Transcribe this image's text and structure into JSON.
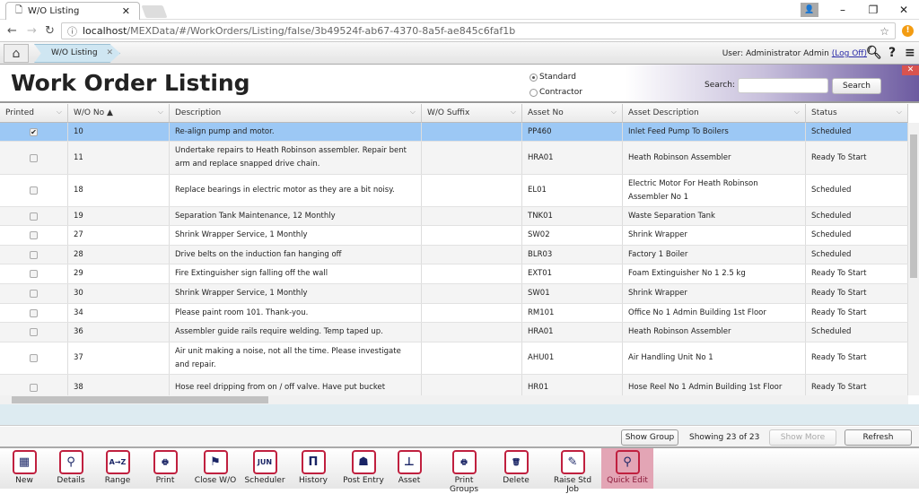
{
  "browser": {
    "tab_title": "W/O Listing",
    "url_host": "localhost",
    "url_path": "/MEXData/#/WorkOrders/Listing/false/3b49524f-ab67-4370-8a5f-ae845c6faf1b"
  },
  "app": {
    "tab_label": "W/O Listing",
    "user_label": "User: Administrator Admin",
    "logoff_label": "(Log Off)"
  },
  "header": {
    "title": "Work Order Listing",
    "radio_standard": "Standard",
    "radio_contractor": "Contractor",
    "selected_mode": "Standard",
    "search_label": "Search:",
    "search_value": "",
    "search_button": "Search"
  },
  "table": {
    "columns": [
      "Printed",
      "W/O No ▲",
      "Description",
      "W/O Suffix",
      "Asset No",
      "Asset Description",
      "Status"
    ],
    "rows": [
      {
        "printed": true,
        "wo": "10",
        "desc": "Re-align pump and motor.",
        "suffix": "",
        "asset": "PP460",
        "asset_desc": "Inlet Feed Pump To Boilers",
        "status": "Scheduled",
        "selected": true
      },
      {
        "printed": false,
        "wo": "11",
        "desc": "Undertake repairs to Heath Robinson assembler. Repair bent arm and replace snapped drive chain.",
        "suffix": "",
        "asset": "HRA01",
        "asset_desc": "Heath Robinson Assembler",
        "status": "Ready To Start"
      },
      {
        "printed": false,
        "wo": "18",
        "desc": "Replace bearings in electric motor as they are a bit noisy.",
        "suffix": "",
        "asset": "EL01",
        "asset_desc": "Electric Motor For Heath Robinson Assembler No 1",
        "status": "Scheduled"
      },
      {
        "printed": false,
        "wo": "19",
        "desc": "Separation Tank Maintenance, 12 Monthly",
        "suffix": "",
        "asset": "TNK01",
        "asset_desc": "Waste Separation Tank",
        "status": "Scheduled"
      },
      {
        "printed": false,
        "wo": "27",
        "desc": "Shrink Wrapper Service, 1 Monthly",
        "suffix": "",
        "asset": "SW02",
        "asset_desc": "Shrink Wrapper",
        "status": "Scheduled"
      },
      {
        "printed": false,
        "wo": "28",
        "desc": "Drive belts on the induction fan hanging off",
        "suffix": "",
        "asset": "BLR03",
        "asset_desc": "Factory 1 Boiler",
        "status": "Scheduled"
      },
      {
        "printed": false,
        "wo": "29",
        "desc": "Fire Extinguisher sign falling off the wall",
        "suffix": "",
        "asset": "EXT01",
        "asset_desc": "Foam Extinguisher No 1 2.5 kg",
        "status": "Ready To Start"
      },
      {
        "printed": false,
        "wo": "30",
        "desc": "Shrink Wrapper Service, 1 Monthly",
        "suffix": "",
        "asset": "SW01",
        "asset_desc": "Shrink Wrapper",
        "status": "Ready To Start"
      },
      {
        "printed": false,
        "wo": "34",
        "desc": "Please paint room 101. Thank-you.",
        "suffix": "",
        "asset": "RM101",
        "asset_desc": "Office No 1 Admin Building 1st Floor",
        "status": "Ready To Start"
      },
      {
        "printed": false,
        "wo": "36",
        "desc": "Assembler guide rails require welding. Temp taped up.",
        "suffix": "",
        "asset": "HRA01",
        "asset_desc": "Heath Robinson Assembler",
        "status": "Scheduled"
      },
      {
        "printed": false,
        "wo": "37",
        "desc": "Air unit making a noise, not all the time. Please investigate and repair.",
        "suffix": "",
        "asset": "AHU01",
        "asset_desc": "Air Handling Unit No 1",
        "status": "Ready To Start"
      },
      {
        "printed": false,
        "wo": "38",
        "desc": "Hose reel dripping from on / off valve. Have put bucket",
        "suffix": "",
        "asset": "HR01",
        "asset_desc": "Hose Reel No 1 Admin Building 1st Floor",
        "status": "Ready To Start"
      }
    ]
  },
  "footer": {
    "show_group": "Show Group",
    "showing": "Showing 23 of 23",
    "show_more": "Show More",
    "refresh": "Refresh"
  },
  "toolbar": [
    {
      "label": "New",
      "icon": "new-calendar-icon",
      "glyph": "▦"
    },
    {
      "label": "Details",
      "icon": "magnifier-icon",
      "glyph": "⚲"
    },
    {
      "label": "Range",
      "icon": "a-to-z-icon",
      "glyph": "A→Z"
    },
    {
      "label": "Print",
      "icon": "printer-icon",
      "glyph": "🖶"
    },
    {
      "label": "Close W/O",
      "icon": "checkered-flag-icon",
      "glyph": "⚑"
    },
    {
      "label": "Scheduler",
      "icon": "calendar-jun-icon",
      "glyph": "JUN"
    },
    {
      "label": "History",
      "icon": "history-icon",
      "glyph": "П"
    },
    {
      "label": "Post Entry",
      "icon": "post-entry-icon",
      "glyph": "☗"
    },
    {
      "label": "Asset",
      "icon": "asset-icon",
      "glyph": "⊥"
    },
    {
      "label": "Print Groups",
      "icon": "print-groups-icon",
      "glyph": "🖶"
    },
    {
      "label": "Delete",
      "icon": "trash-icon",
      "glyph": "🗑"
    },
    {
      "label": "Raise Std Job",
      "icon": "raise-job-icon",
      "glyph": "✎"
    },
    {
      "label": "Quick Edit",
      "icon": "quick-edit-icon",
      "glyph": "⚲",
      "active": true
    }
  ],
  "colors": {
    "selected_row": "#9cc8f5",
    "accent": "#c0203f",
    "header_gradient": "#6c5aa0"
  }
}
